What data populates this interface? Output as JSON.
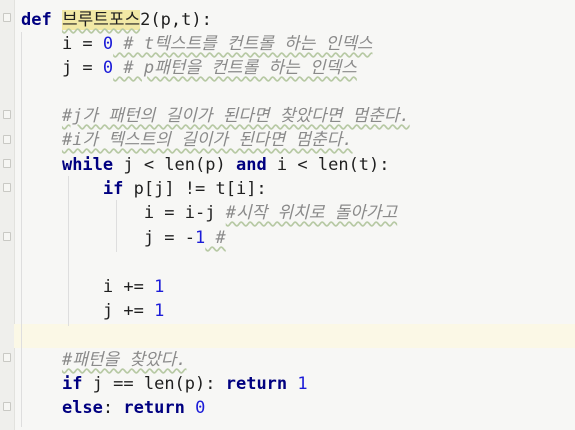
{
  "code": {
    "l1": {
      "kw_def": "def",
      "fn_name": "브루트포스",
      "params": "2(p,t):"
    },
    "l2": {
      "pre": "i = ",
      "num": "0",
      "comment": " # t텍스트를 컨트롤 하는 인덱스"
    },
    "l3": {
      "pre": "j = ",
      "num": "0",
      "comment": " # p패턴을 컨트롤 하는 인덱스"
    },
    "l5": {
      "comment": "#j가 패턴의 길이가 된다면 찾았다면 멈춘다."
    },
    "l6": {
      "comment": "#i가 텍스트의 길이가 된다면 멈춘다."
    },
    "l7": {
      "kw_while": "while",
      "p1": " j < len(p) ",
      "kw_and": "and",
      "p2": " i < len(t):"
    },
    "l8": {
      "kw_if": "if",
      "rest": " p[j] != t[i]:"
    },
    "l9": {
      "pre": "i = i-j ",
      "comment": "#시작 위치로 돌아가고"
    },
    "l10": {
      "pre": "j = -",
      "num": "1",
      "comment": " #"
    },
    "l12": {
      "pre": "i += ",
      "num": "1"
    },
    "l13": {
      "pre": "j += ",
      "num": "1"
    },
    "l15": {
      "comment": "#패턴을 찾았다."
    },
    "l16": {
      "kw_if": "if",
      "mid": " j == len(p): ",
      "kw_return": "return",
      "sp": " ",
      "num": "1"
    },
    "l17": {
      "kw_else": "else",
      "colon": ": ",
      "kw_return": "return",
      "sp": " ",
      "num": "0"
    }
  }
}
